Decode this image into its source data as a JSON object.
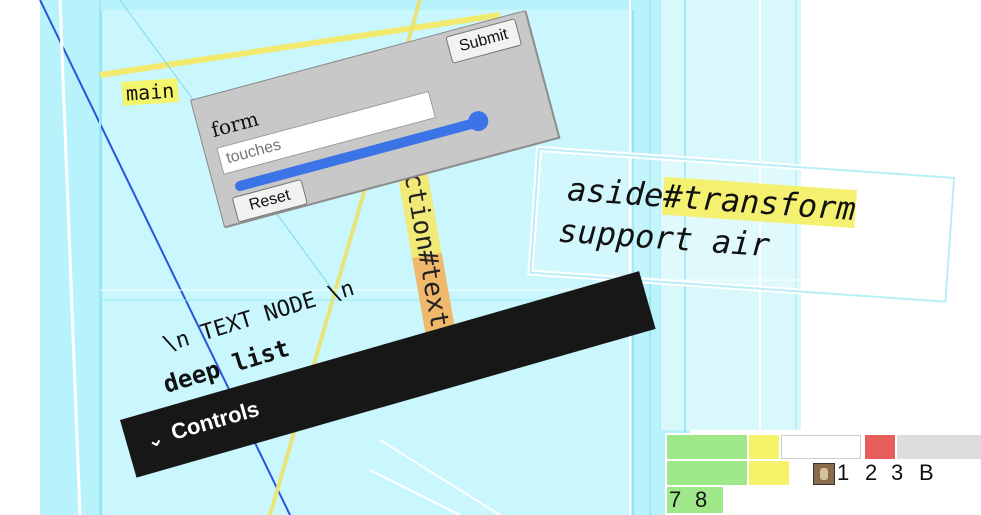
{
  "scene": {
    "main_label": "main",
    "section_text_label": "section#text"
  },
  "form": {
    "label": "form",
    "input_placeholder": "touches",
    "submit_label": "Submit",
    "reset_label": "Reset",
    "slider_value": 0.95
  },
  "aside": {
    "title_prefix": "aside",
    "title_highlight": "#transform",
    "body": "support air"
  },
  "text_node": "\\n TEXT NODE \\n",
  "deep_list": "deep list",
  "controls": {
    "chevron": "⌄",
    "label": "Controls"
  },
  "legend": {
    "numbers_row2": [
      "1",
      "2",
      "3",
      "B"
    ],
    "numbers_row3": [
      "7",
      "8"
    ],
    "colors": {
      "green": "#9fe88a",
      "yellow": "#f4f36a",
      "red": "#e85c5c",
      "gray": "#dcdcdc"
    }
  },
  "colors": {
    "scene_cyan": "#b8f3fb",
    "highlight_yellow": "#f3f56d",
    "slider_blue": "#3b74e6",
    "controls_bg": "#171717"
  }
}
